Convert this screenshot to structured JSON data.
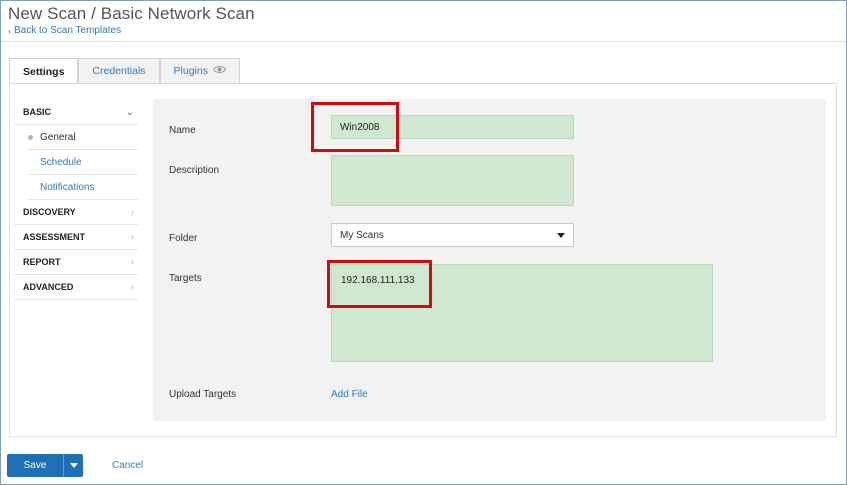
{
  "header": {
    "title": "New Scan / Basic Network Scan",
    "back_link": "Back to Scan Templates"
  },
  "tabs": [
    {
      "label": "Settings",
      "active": true
    },
    {
      "label": "Credentials",
      "active": false
    },
    {
      "label": "Plugins",
      "active": false,
      "icon": "eye-icon"
    }
  ],
  "sidebar": {
    "sections": [
      {
        "label": "BASIC",
        "expanded": true,
        "children": [
          {
            "label": "General",
            "active": true
          },
          {
            "label": "Schedule",
            "active": false
          },
          {
            "label": "Notifications",
            "active": false
          }
        ]
      },
      {
        "label": "DISCOVERY",
        "expanded": false
      },
      {
        "label": "ASSESSMENT",
        "expanded": false
      },
      {
        "label": "REPORT",
        "expanded": false
      },
      {
        "label": "ADVANCED",
        "expanded": false
      }
    ]
  },
  "form": {
    "name_label": "Name",
    "name_value": "Win2008",
    "description_label": "Description",
    "description_value": "",
    "folder_label": "Folder",
    "folder_value": "My Scans",
    "targets_label": "Targets",
    "targets_value": "192.168.111.133",
    "upload_label": "Upload Targets",
    "add_file_label": "Add File"
  },
  "footer": {
    "save_label": "Save",
    "cancel_label": "Cancel"
  },
  "colors": {
    "accent": "#2f7bbf",
    "button": "#1f6fb5",
    "field_bg": "#cfe8cf",
    "highlight": "#d20a0a"
  }
}
